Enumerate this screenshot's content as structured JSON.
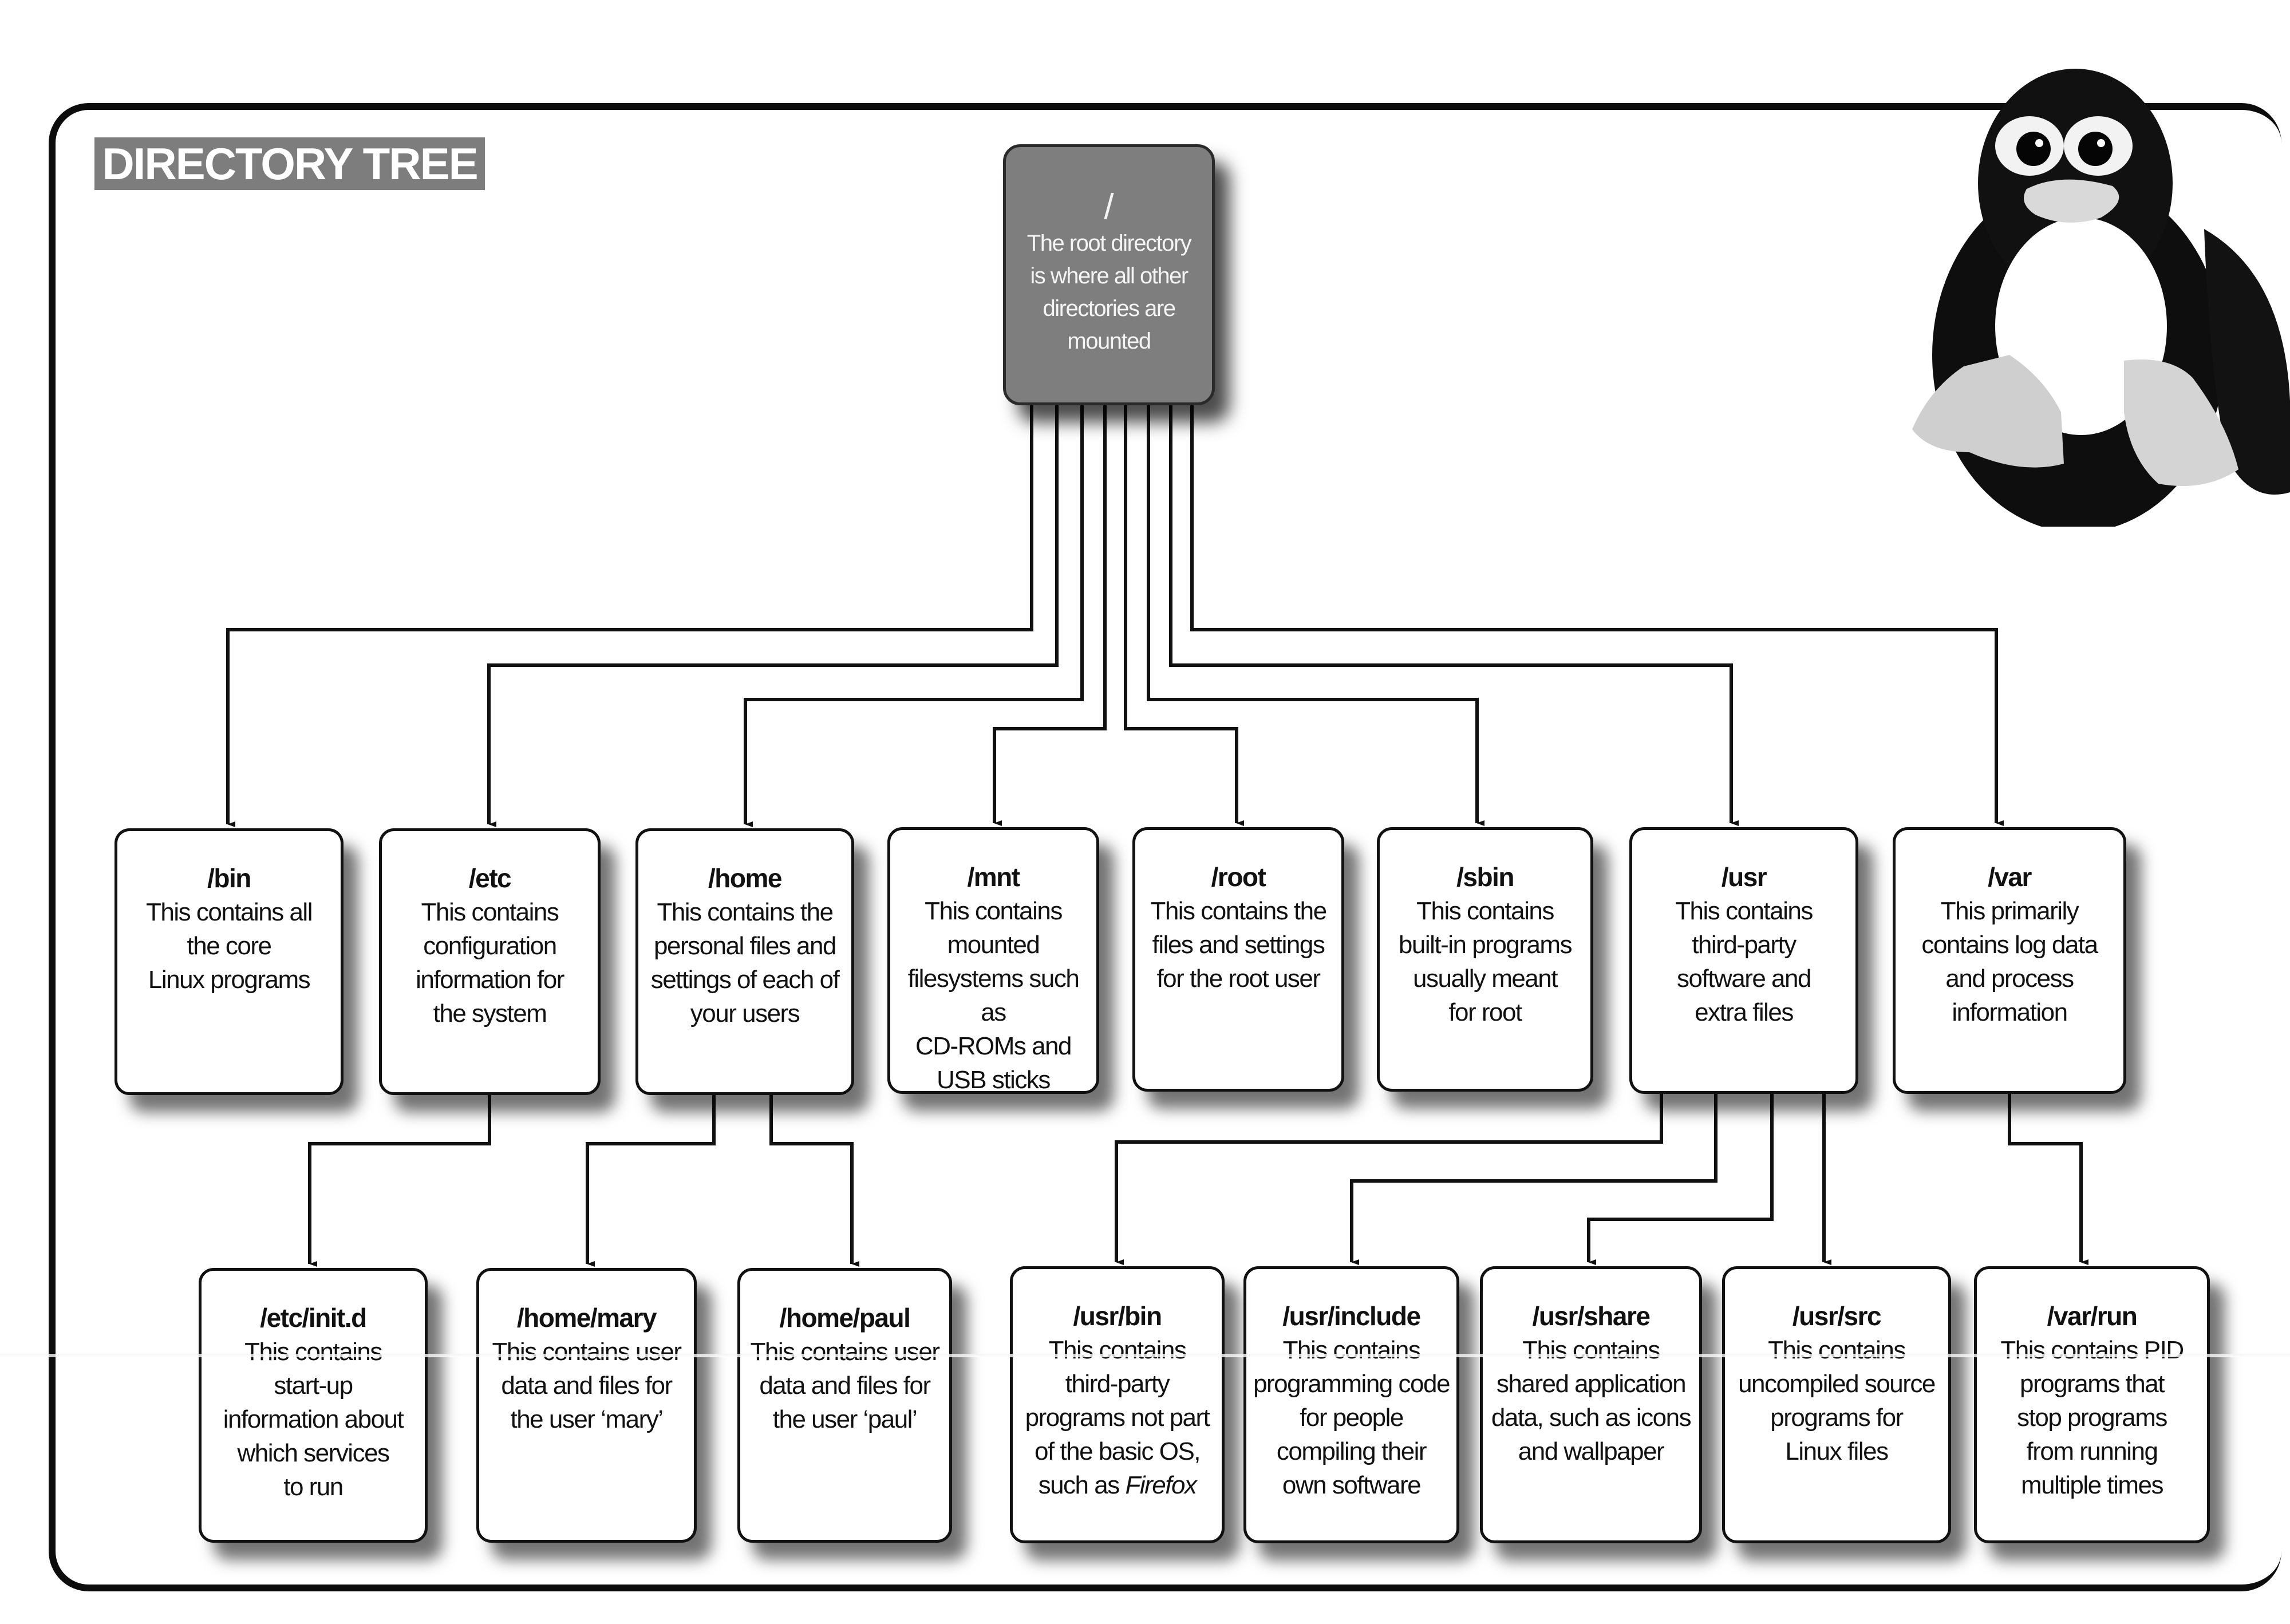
{
  "title": "DIRECTORY TREE",
  "root": {
    "name": "/",
    "description": "The root directory\nis where all other\ndirectories are\nmounted"
  },
  "level1": [
    {
      "name": "/bin",
      "description": "This contains all\nthe core\nLinux programs"
    },
    {
      "name": "/etc",
      "description": "This contains\nconfiguration\ninformation for\nthe system"
    },
    {
      "name": "/home",
      "description": "This contains the\npersonal files and\nsettings of each of\nyour users"
    },
    {
      "name": "/mnt",
      "description": "This contains\nmounted\nfilesystems such as\nCD-ROMs and\nUSB sticks"
    },
    {
      "name": "/root",
      "description": "This contains the\nfiles and settings\nfor the root user"
    },
    {
      "name": "/sbin",
      "description": "This contains\nbuilt-in programs\nusually meant\nfor root"
    },
    {
      "name": "/usr",
      "description": "This contains\nthird-party\nsoftware and\nextra files"
    },
    {
      "name": "/var",
      "description": "This primarily\ncontains log data\nand process\ninformation"
    }
  ],
  "level2": [
    {
      "name": "/etc/init.d",
      "parent": "/etc",
      "description": "This contains\nstart-up\ninformation about\nwhich services\nto run"
    },
    {
      "name": "/home/mary",
      "parent": "/home",
      "description": "This contains user\ndata and files for\nthe user ‘mary’"
    },
    {
      "name": "/home/paul",
      "parent": "/home",
      "description": "This contains user\ndata and files for\nthe user ‘paul’"
    },
    {
      "name": "/usr/bin",
      "parent": "/usr",
      "description": "This contains\nthird-party\nprograms not part\nof the basic OS,\nsuch as",
      "emphasis": "Firefox"
    },
    {
      "name": "/usr/include",
      "parent": "/usr",
      "description": "This contains\nprogramming code\nfor people\ncompiling their\nown software"
    },
    {
      "name": "/usr/share",
      "parent": "/usr",
      "description": "This contains\nshared application\ndata, such as icons\nand wallpaper"
    },
    {
      "name": "/usr/src",
      "parent": "/usr",
      "description": "This contains\nuncompiled source\nprograms for\nLinux files"
    },
    {
      "name": "/var/run",
      "parent": "/var",
      "description": "This contains PID\nprograms that\nstop programs\nfrom running\nmultiple times"
    }
  ],
  "mascot": "tux-penguin",
  "colors": {
    "root_fill": "#7e7e7e",
    "title_fill": "#7d7d7d",
    "line": "#111111",
    "box_fill": "#ffffff"
  }
}
